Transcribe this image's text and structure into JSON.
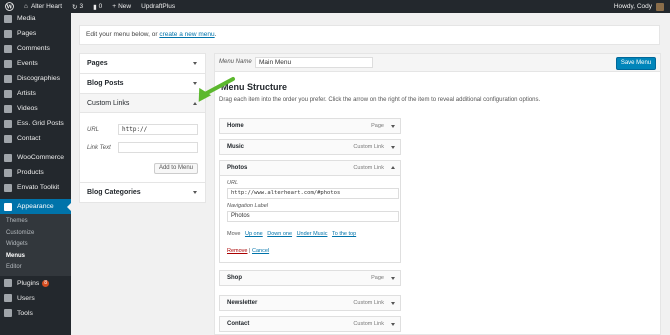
{
  "adminbar": {
    "site_name": "Alter Heart",
    "updates_count": "3",
    "comments_count": "0",
    "new_label": "New",
    "plugin_label": "UpdraftPlus",
    "howdy": "Howdy, Cody"
  },
  "sidebar": {
    "items": [
      {
        "label": "Media",
        "icon": "media-icon"
      },
      {
        "label": "Pages",
        "icon": "pages-icon"
      },
      {
        "label": "Comments",
        "icon": "comments-icon"
      },
      {
        "label": "Events",
        "icon": "calendar-icon"
      },
      {
        "label": "Discographies",
        "icon": "album-icon"
      },
      {
        "label": "Artists",
        "icon": "person-icon"
      },
      {
        "label": "Videos",
        "icon": "video-icon"
      },
      {
        "label": "Ess. Grid Posts",
        "icon": "grid-icon"
      },
      {
        "label": "Contact",
        "icon": "envelope-icon"
      },
      {
        "label": "WooCommerce",
        "icon": "woo-icon"
      },
      {
        "label": "Products",
        "icon": "products-icon"
      },
      {
        "label": "Envato Toolkit",
        "icon": "envato-icon"
      },
      {
        "label": "Appearance",
        "icon": "brush-icon"
      },
      {
        "label": "Plugins",
        "icon": "plug-icon",
        "badge": "8"
      },
      {
        "label": "Users",
        "icon": "users-icon"
      },
      {
        "label": "Tools",
        "icon": "wrench-icon"
      }
    ],
    "appearance_sub": [
      "Themes",
      "Customize",
      "Widgets",
      "Menus",
      "Editor"
    ],
    "active_sub": "Menus",
    "accent": "#0073aa"
  },
  "topbox": {
    "text": "Edit your menu below, or ",
    "link": "create a new menu",
    "suffix": "."
  },
  "leftcol": {
    "pages": "Pages",
    "blog_posts": "Blog Posts",
    "custom_links": "Custom Links",
    "url_label": "URL",
    "url_value": "http://",
    "link_text_label": "Link Text",
    "link_text_value": "",
    "add_button": "Add to Menu",
    "blog_categories": "Blog Categories"
  },
  "rightcol": {
    "menu_name_label": "Menu Name",
    "menu_name_value": "Main Menu",
    "save_button": "Save Menu",
    "structure_title": "Menu Structure",
    "structure_sub": "Drag each item into the order you prefer. Click the arrow on the right of the item to reveal additional configuration options.",
    "items": [
      {
        "title": "Home",
        "type": "Page"
      },
      {
        "title": "Music",
        "type": "Custom Link"
      },
      {
        "title": "Photos",
        "type": "Custom Link"
      },
      {
        "title": "Shop",
        "type": "Page"
      },
      {
        "title": "Newsletter",
        "type": "Custom Link"
      },
      {
        "title": "Contact",
        "type": "Custom Link"
      }
    ],
    "expanded": {
      "url_label": "URL",
      "url_value": "http://www.alterheart.com/#photos",
      "nav_label": "Navigation Label",
      "nav_value": "Photos",
      "move_label": "Move",
      "move_up": "Up one",
      "move_down": "Down one",
      "move_under": "Under Music",
      "move_top": "To the top",
      "remove": "Remove",
      "separator": "|",
      "cancel": "Cancel"
    }
  },
  "colors": {
    "annotation_arrow": "#5cb82e",
    "primary_button": "#0085ba"
  }
}
